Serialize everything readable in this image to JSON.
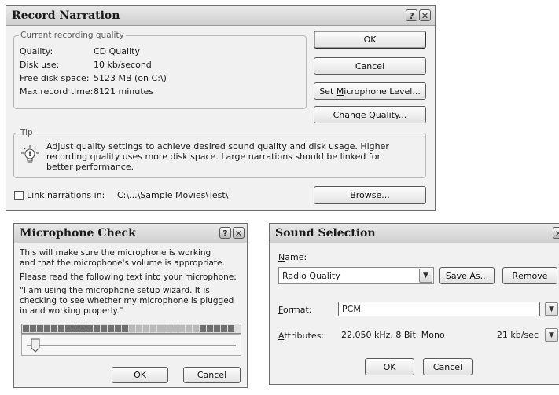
{
  "record_narration": {
    "title": "Record Narration",
    "help_btn": "?",
    "close_btn": "✕",
    "quality_group": {
      "legend": "Current recording quality",
      "rows": [
        {
          "label": "Quality:",
          "value": "CD Quality"
        },
        {
          "label": "Disk use:",
          "value": "10 kb/second"
        },
        {
          "label": "Free disk space:",
          "value": "5123 MB (on C:\\)"
        },
        {
          "label": "Max record time:",
          "value": "8121 minutes"
        }
      ]
    },
    "buttons": {
      "ok": "OK",
      "cancel": "Cancel",
      "set_mic_pre": "Set ",
      "set_mic_u": "M",
      "set_mic_post": "icrophone Level...",
      "change_u": "C",
      "change_post": "hange Quality...",
      "browse_u": "B",
      "browse_post": "rowse..."
    },
    "tip": {
      "legend": "Tip",
      "text": "Adjust quality settings to achieve desired sound quality and disk usage. Higher recording quality uses more disk space. Large narrations should be linked for better performance."
    },
    "link": {
      "label_u": "L",
      "label_post": "ink narrations in:",
      "path": "C:\\...\\Sample Movies\\Test\\",
      "checked": false
    }
  },
  "mic_check": {
    "title": "Microphone Check",
    "help_btn": "?",
    "close_btn": "✕",
    "line1": "This will make sure the microphone is working and that the microphone's volume is appropriate.",
    "line2": "Please read the following text into your microphone:",
    "quote": "\"I am using the microphone setup wizard. It is checking to see whether my microphone is plugged in and working properly.\"",
    "meter_colors": {
      "dark": "#6f6f6f",
      "light": "#b9b9b9"
    },
    "buttons": {
      "ok": "OK",
      "cancel": "Cancel"
    }
  },
  "sound_selection": {
    "title": "Sound Selection",
    "close_btn": "✕",
    "name_label_u": "N",
    "name_label_post": "ame:",
    "name_value": "Radio Quality",
    "save_as_u": "S",
    "save_as_post": "ave As...",
    "remove_u": "R",
    "remove_post": "emove",
    "format_label_u": "F",
    "format_label_post": "ormat:",
    "format_value": "PCM",
    "attributes_label_u": "A",
    "attributes_label_post": "ttributes:",
    "attributes_value": "22.050 kHz, 8 Bit, Mono",
    "attributes_rate": "21 kb/sec",
    "buttons": {
      "ok": "OK",
      "cancel": "Cancel"
    }
  }
}
